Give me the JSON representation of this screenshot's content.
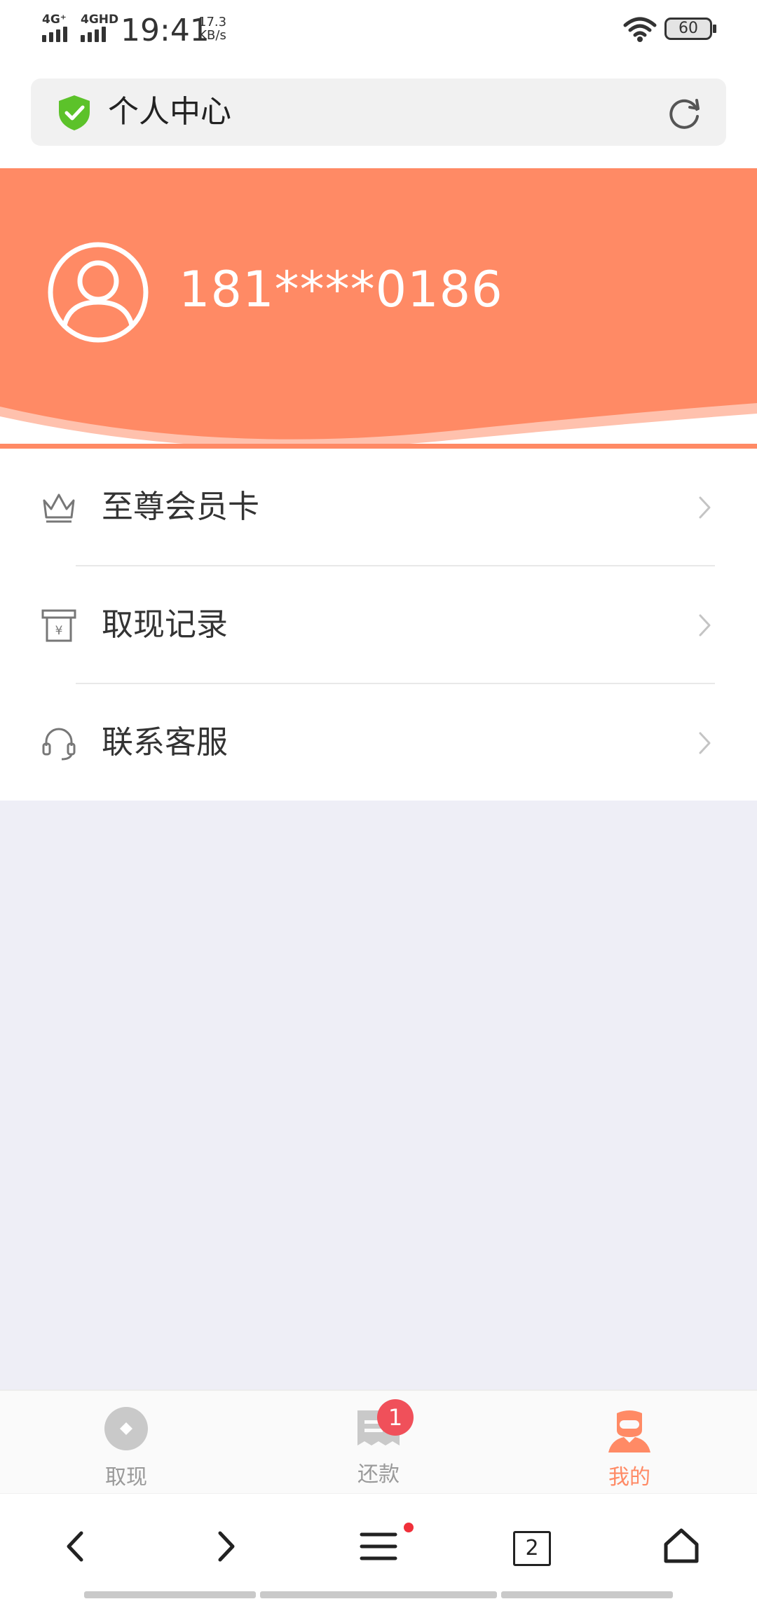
{
  "status_bar": {
    "network1": "4G⁺",
    "network2": "4GHD",
    "time": "19:41",
    "speed_value": "17.3",
    "speed_unit": "KB/s",
    "battery": "60"
  },
  "address_bar": {
    "title": "个人中心",
    "icons": [
      "shield-check-icon",
      "refresh-icon"
    ],
    "shield_color": "#5cc22a"
  },
  "header": {
    "phone": "181****0186",
    "background_color": "#ff8a65"
  },
  "menu": {
    "items": [
      {
        "label": "至尊会员卡",
        "icon": "crown-icon"
      },
      {
        "label": "取现记录",
        "icon": "cash-record-icon"
      },
      {
        "label": "联系客服",
        "icon": "headset-icon"
      }
    ]
  },
  "tabbar": {
    "tabs": [
      {
        "label": "取现",
        "icon": "coin-icon",
        "active": false
      },
      {
        "label": "还款",
        "icon": "receipt-icon",
        "active": false,
        "badge": "1"
      },
      {
        "label": "我的",
        "icon": "user-icon",
        "active": true
      }
    ],
    "active_color": "#ff8a65"
  },
  "browser_bar": {
    "tab_count": "2",
    "icons": [
      "back-icon",
      "forward-icon",
      "menu-icon",
      "tabs-icon",
      "home-icon"
    ]
  }
}
